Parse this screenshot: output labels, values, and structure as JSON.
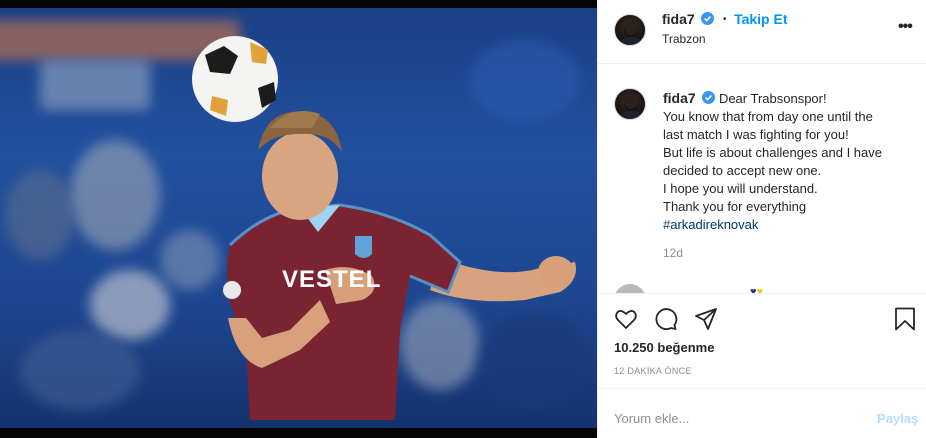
{
  "post": {
    "author": "fida7",
    "follow_label": "Takip Et",
    "location": "Trabzon",
    "more_icon": "more-dots-icon",
    "caption_lines": [
      "Dear Trabsonspor!",
      "You know that from day one until the",
      "last match I was fighting for you!",
      "But life is about challenges and I have",
      "decided to accept new one.",
      "I hope you will understand.",
      "Thank you for everything"
    ],
    "hashtag": "#arkadireknovak",
    "age": "12d",
    "likes": "10.250 beğenme",
    "timestamp": "12 DAKİKA ÖNCE",
    "comment_placeholder": "Yorum ekle...",
    "post_button": "Paylaş"
  },
  "colors": {
    "accent": "#0095f6",
    "hashtag": "#00376b",
    "muted": "#8e8e8e",
    "post_disabled": "#b2dffc"
  },
  "photo": {
    "jersey_text": "VESTEL"
  }
}
